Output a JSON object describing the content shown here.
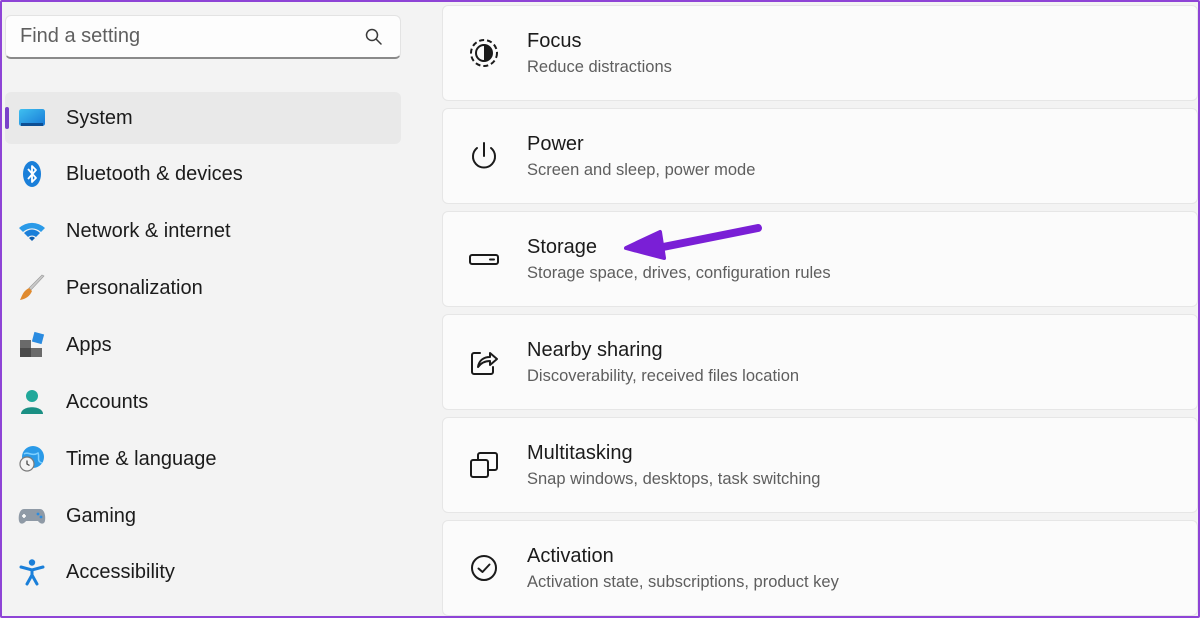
{
  "search": {
    "placeholder": "Find a setting",
    "icon": "search-icon"
  },
  "sidebar": {
    "selected": "System",
    "items": [
      {
        "label": "System",
        "icon": "system-monitor-icon"
      },
      {
        "label": "Bluetooth & devices",
        "icon": "bluetooth-icon"
      },
      {
        "label": "Network & internet",
        "icon": "wifi-icon"
      },
      {
        "label": "Personalization",
        "icon": "paintbrush-icon"
      },
      {
        "label": "Apps",
        "icon": "apps-icon"
      },
      {
        "label": "Accounts",
        "icon": "account-icon"
      },
      {
        "label": "Time & language",
        "icon": "globe-clock-icon"
      },
      {
        "label": "Gaming",
        "icon": "gamepad-icon"
      },
      {
        "label": "Accessibility",
        "icon": "accessibility-icon"
      }
    ]
  },
  "settings": [
    {
      "title": "Focus",
      "subtitle": "Reduce distractions",
      "icon": "focus-icon"
    },
    {
      "title": "Power",
      "subtitle": "Screen and sleep, power mode",
      "icon": "power-icon"
    },
    {
      "title": "Storage",
      "subtitle": "Storage space, drives, configuration rules",
      "icon": "storage-drive-icon"
    },
    {
      "title": "Nearby sharing",
      "subtitle": "Discoverability, received files location",
      "icon": "share-icon"
    },
    {
      "title": "Multitasking",
      "subtitle": "Snap windows, desktops, task switching",
      "icon": "multitasking-icon"
    },
    {
      "title": "Activation",
      "subtitle": "Activation state, subscriptions, product key",
      "icon": "checkmark-circle-icon"
    }
  ],
  "annotation": {
    "icon": "arrow-annotation-icon",
    "color": "#7a1fd6",
    "points_to": "Storage"
  },
  "colors": {
    "accent": "#7a40c9",
    "frame": "#8e44d6"
  }
}
